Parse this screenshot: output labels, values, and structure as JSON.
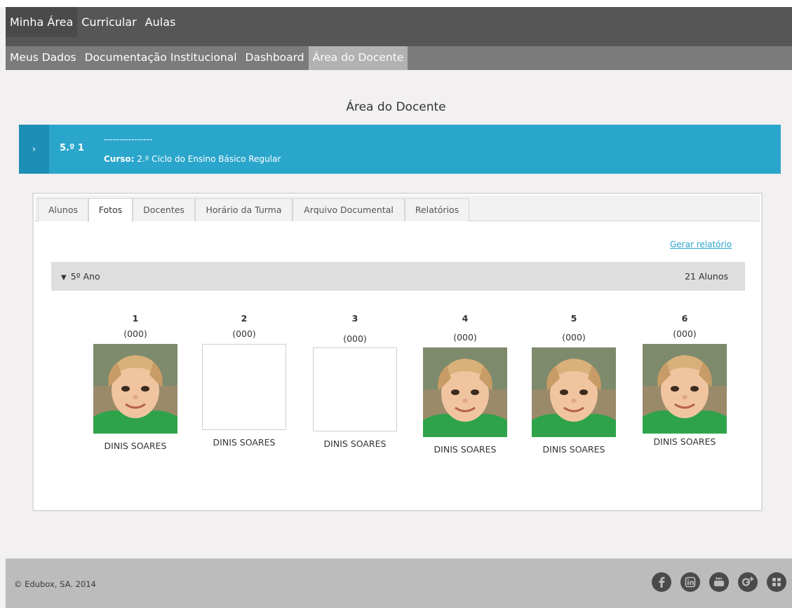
{
  "nav_primary": [
    {
      "label": "Minha Área"
    },
    {
      "label": "Curricular"
    },
    {
      "label": "Aulas"
    }
  ],
  "nav_secondary": [
    {
      "label": "Meus Dados"
    },
    {
      "label": "Documentação Institucional"
    },
    {
      "label": "Dashboard"
    },
    {
      "label": "Área do Docente"
    }
  ],
  "page": {
    "title": "Área do Docente"
  },
  "class_bar": {
    "toggle": "›",
    "code": "5.º 1",
    "dashes": "----------------",
    "course_label": "Curso:",
    "course_value": " 2.º Ciclo do Ensino Básico Regular"
  },
  "tabs": [
    {
      "label": "Alunos"
    },
    {
      "label": "Fotos"
    },
    {
      "label": "Docentes"
    },
    {
      "label": "Horário da Turma"
    },
    {
      "label": "Arquivo Documental"
    },
    {
      "label": "Relatórios"
    }
  ],
  "report_link": "Gerar relatório",
  "year_group": {
    "caret": "▼",
    "label": "5º Ano",
    "count": "21 Alunos"
  },
  "students": [
    {
      "number": "1",
      "code": "(000)",
      "name": "DINIS SOARES",
      "has_photo": true
    },
    {
      "number": "2",
      "code": "(000)",
      "name": "DINIS SOARES",
      "has_photo": false
    },
    {
      "number": "3",
      "code": "(000)",
      "name": "DINIS SOARES",
      "has_photo": false
    },
    {
      "number": "4",
      "code": "(000)",
      "name": "DINIS SOARES",
      "has_photo": true
    },
    {
      "number": "5",
      "code": "(000)",
      "name": "DINIS SOARES",
      "has_photo": true
    },
    {
      "number": "6",
      "code": "(000)",
      "name": "DINIS SOARES",
      "has_photo": true
    }
  ],
  "footer": {
    "copyright": "© Edubox, SA. 2014",
    "social_icons": [
      "facebook-icon",
      "linkedin-icon",
      "youtube-icon",
      "google-plus-icon",
      "extra-icon"
    ]
  },
  "colors": {
    "nav_primary_bg": "#565656",
    "nav_secondary_bg": "#7b7b7b",
    "accent": "#2aa6cc",
    "accent_dark": "#1d8fb6",
    "footer_bg": "#bcbcbc"
  }
}
